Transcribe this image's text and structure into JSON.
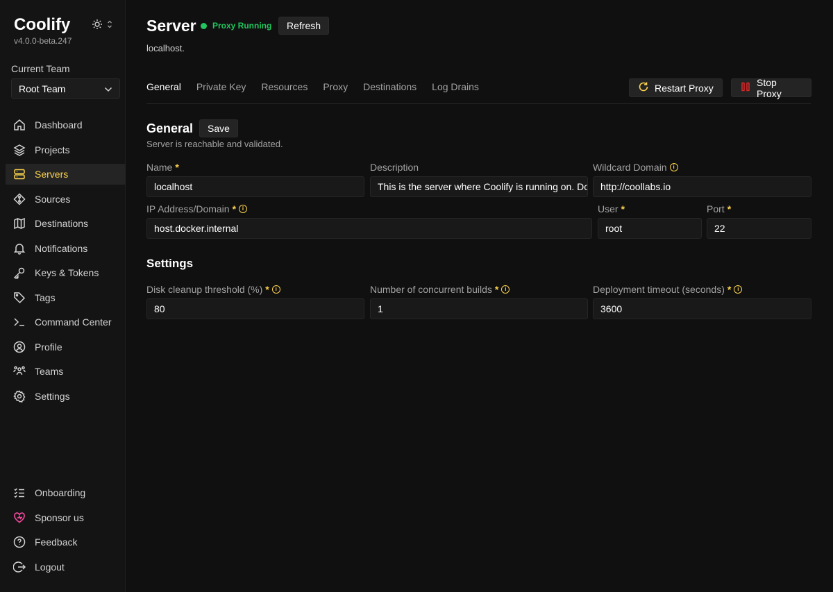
{
  "sidebar": {
    "brand": "Coolify",
    "version": "v4.0.0-beta.247",
    "team_label": "Current Team",
    "team_value": "Root Team",
    "items": [
      {
        "label": "Dashboard",
        "icon": "home-icon"
      },
      {
        "label": "Projects",
        "icon": "layers-icon"
      },
      {
        "label": "Servers",
        "icon": "server-icon",
        "active": true
      },
      {
        "label": "Sources",
        "icon": "git-icon"
      },
      {
        "label": "Destinations",
        "icon": "destination-icon"
      },
      {
        "label": "Notifications",
        "icon": "bell-icon"
      },
      {
        "label": "Keys & Tokens",
        "icon": "key-icon"
      },
      {
        "label": "Tags",
        "icon": "tag-icon"
      },
      {
        "label": "Command Center",
        "icon": "terminal-icon"
      },
      {
        "label": "Profile",
        "icon": "user-icon"
      },
      {
        "label": "Teams",
        "icon": "users-icon"
      },
      {
        "label": "Settings",
        "icon": "gear-icon"
      }
    ],
    "bottom_items": [
      {
        "label": "Onboarding",
        "icon": "checklist-icon"
      },
      {
        "label": "Sponsor us",
        "icon": "heart-icon"
      },
      {
        "label": "Feedback",
        "icon": "question-icon"
      },
      {
        "label": "Logout",
        "icon": "logout-icon"
      }
    ]
  },
  "header": {
    "title": "Server",
    "status": "Proxy Running",
    "refresh_label": "Refresh",
    "subtitle": "localhost."
  },
  "tabs": [
    "General",
    "Private Key",
    "Resources",
    "Proxy",
    "Destinations",
    "Log Drains"
  ],
  "actions": {
    "restart_label": "Restart Proxy",
    "stop_label": "Stop Proxy"
  },
  "general": {
    "heading": "General",
    "save_label": "Save",
    "status_text": "Server is reachable and validated.",
    "name_label": "Name",
    "name_value": "localhost",
    "description_label": "Description",
    "description_value": "This is the server where Coolify is running on. Don't delete this!",
    "wildcard_label": "Wildcard Domain",
    "wildcard_value": "http://coollabs.io",
    "ip_label": "IP Address/Domain",
    "ip_value": "host.docker.internal",
    "user_label": "User",
    "user_value": "root",
    "port_label": "Port",
    "port_value": "22",
    "required_mark": "*"
  },
  "settings": {
    "heading": "Settings",
    "disk_label": "Disk cleanup threshold (%)",
    "disk_value": "80",
    "builds_label": "Number of concurrent builds",
    "builds_value": "1",
    "timeout_label": "Deployment timeout (seconds)",
    "timeout_value": "3600"
  },
  "colors": {
    "accent": "#fcd34d",
    "running": "#22c55e",
    "stop": "#dc2626",
    "sponsor": "#ec4899"
  }
}
